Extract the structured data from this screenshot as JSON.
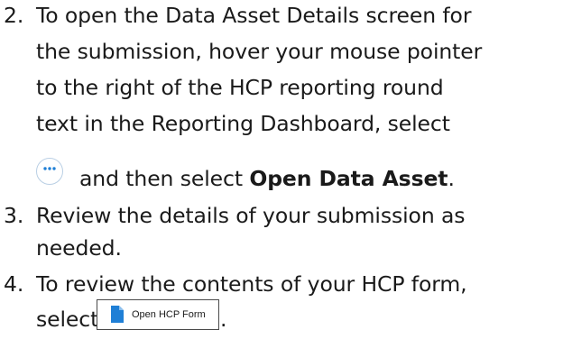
{
  "steps": [
    {
      "number": "2.",
      "lines": [
        "To open the Data Asset Details screen for",
        "the submission, hover your mouse pointer",
        "to the right of the HCP reporting round",
        "text in the Reporting Dashboard, select"
      ],
      "icon_line_text": "and then select",
      "icon_line_bold": "Open Data Asset",
      "icon_line_end": ".",
      "inline_icon": "more-options-icon"
    },
    {
      "number": "3.",
      "lines": [
        "Review the details of your submission as",
        "needed."
      ]
    },
    {
      "number": "4.",
      "lines": [
        "To review the contents of your HCP form,"
      ],
      "select_word": "select",
      "end_period": ".",
      "button": {
        "label": "Open HCP Form",
        "icon": "document-icon",
        "icon_color": "#1f7fd6"
      }
    }
  ],
  "colors": {
    "text": "#1a1a1a",
    "more_button_border": "#b9cfe4",
    "more_button_dots": "#1f7fd6",
    "form_button_border": "#4a4a4a"
  }
}
